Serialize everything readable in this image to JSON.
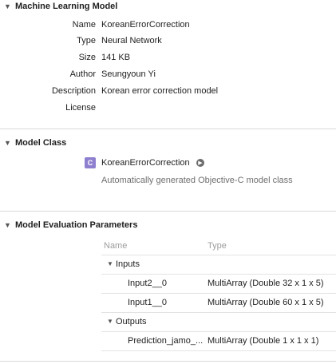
{
  "sections": {
    "ml_model": {
      "title": "Machine Learning Model",
      "fields": [
        {
          "key": "Name",
          "value": "KoreanErrorCorrection"
        },
        {
          "key": "Type",
          "value": "Neural Network"
        },
        {
          "key": "Size",
          "value": "141 KB"
        },
        {
          "key": "Author",
          "value": "Seungyoun Yi"
        },
        {
          "key": "Description",
          "value": "Korean error correction model"
        },
        {
          "key": "License",
          "value": ""
        }
      ]
    },
    "model_class": {
      "title": "Model Class",
      "badge": "C",
      "class_name": "KoreanErrorCorrection",
      "description": "Automatically generated Objective-C model class"
    },
    "eval_params": {
      "title": "Model Evaluation Parameters",
      "columns": {
        "name": "Name",
        "type": "Type"
      },
      "inputs_label": "Inputs",
      "inputs": [
        {
          "name": "Input2__0",
          "type": "MultiArray (Double 32 x 1 x 5)"
        },
        {
          "name": "Input1__0",
          "type": "MultiArray (Double 60 x 1 x 5)"
        }
      ],
      "outputs_label": "Outputs",
      "outputs": [
        {
          "name": "Prediction_jamo_...",
          "type": "MultiArray (Double 1 x 1 x 1)"
        }
      ]
    }
  },
  "icons": {
    "disclosure": "triangle-down-icon",
    "class_arrow": "arrow-right-circle-icon"
  }
}
